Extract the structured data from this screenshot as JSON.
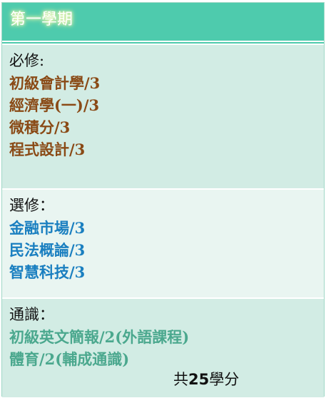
{
  "semester": {
    "title": "第一學期"
  },
  "required": {
    "heading": "必修:",
    "courses": [
      "初級會計學/3",
      "經濟學(一)/3",
      "微積分/3",
      "程式設計/3"
    ]
  },
  "elective": {
    "heading": "選修：",
    "courses": [
      "金融市場/3",
      "民法概論/3",
      "智慧科技/3"
    ]
  },
  "general": {
    "heading": "通識：",
    "courses": [
      "初級英文簡報/2(外語課程)",
      "體育/2(輔成通識)"
    ]
  },
  "total": {
    "prefix": "共",
    "credits": "25",
    "suffix": "學分"
  },
  "colors": {
    "header": "#4ecbad",
    "required_bg": "#d2ece4",
    "elective_bg": "#e9f5f1",
    "required_text": "#8a4a16",
    "elective_text": "#1a7fc0",
    "general_text": "#4ba88e"
  }
}
